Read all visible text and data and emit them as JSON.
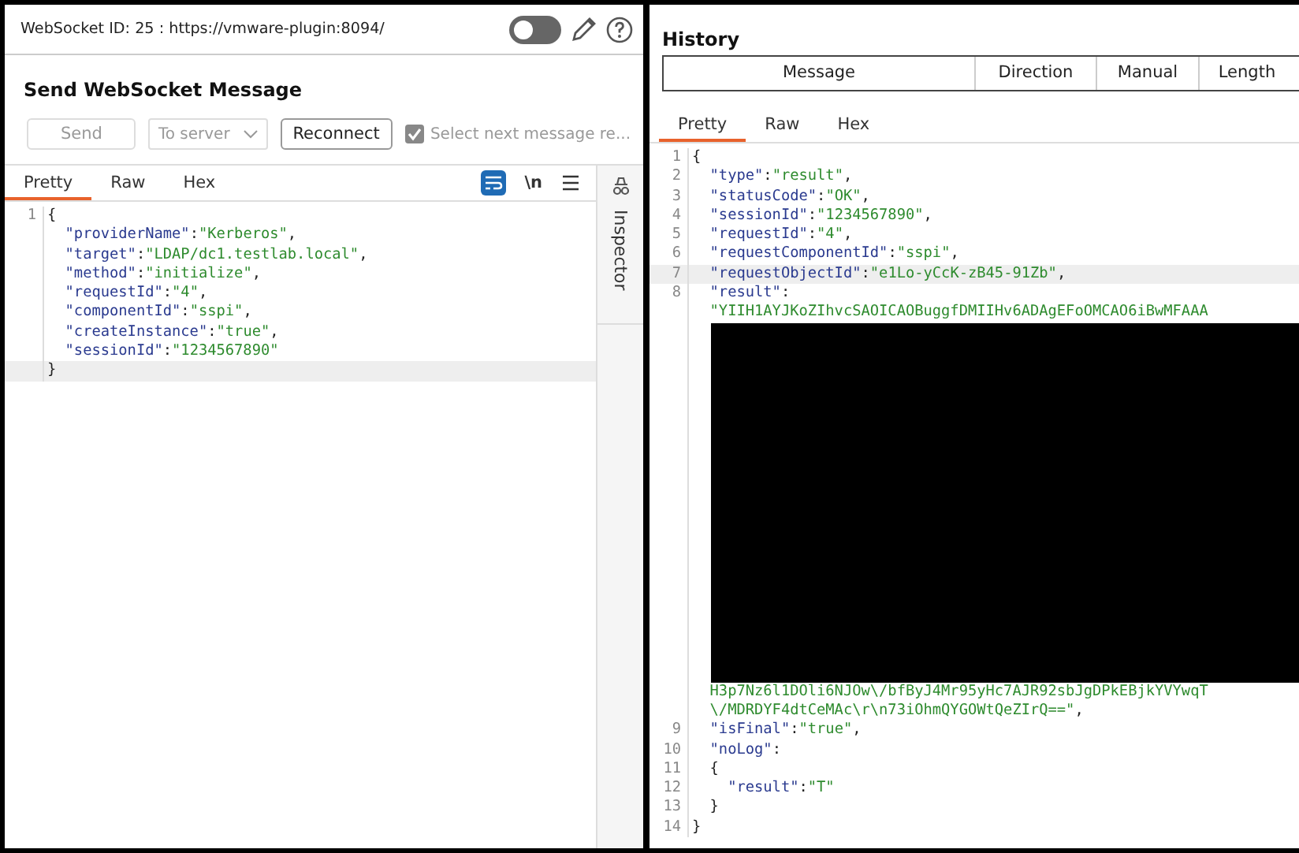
{
  "left_pane": {
    "header": {
      "title": "WebSocket ID: 25 : https://vmware-plugin:8094/",
      "intercept_toggle": {
        "on": false
      }
    },
    "send_section": {
      "title": "Send WebSocket Message",
      "send_button": {
        "label": "Send",
        "disabled": true
      },
      "direction_select": {
        "value": "To server",
        "disabled": true
      },
      "reconnect_button": {
        "label": "Reconnect",
        "disabled": false
      },
      "select_next_checkbox": {
        "label": "Select next message re...",
        "checked": true,
        "disabled": true
      }
    },
    "editor_tabs": [
      {
        "label": "Pretty",
        "selected": true
      },
      {
        "label": "Raw",
        "selected": false
      },
      {
        "label": "Hex",
        "selected": false
      }
    ],
    "editor_tools": {
      "wrap_on": true,
      "newline_label": "\\n"
    },
    "code_lines": [
      {
        "kind": "code",
        "number": "1",
        "current": false,
        "tokens": [
          {
            "kind": "punct",
            "text": "{"
          }
        ]
      },
      {
        "kind": "code",
        "current": false,
        "tokens": [
          {
            "kind": "key",
            "text": "  \"providerName\""
          },
          {
            "kind": "punct",
            "text": ":"
          },
          {
            "kind": "string",
            "text": "\"Kerberos\""
          },
          {
            "kind": "punct",
            "text": ","
          }
        ]
      },
      {
        "kind": "code",
        "current": false,
        "tokens": [
          {
            "kind": "key",
            "text": "  \"target\""
          },
          {
            "kind": "punct",
            "text": ":"
          },
          {
            "kind": "string",
            "text": "\"LDAP/dc1.testlab.local\""
          },
          {
            "kind": "punct",
            "text": ","
          }
        ]
      },
      {
        "kind": "code",
        "current": false,
        "tokens": [
          {
            "kind": "key",
            "text": "  \"method\""
          },
          {
            "kind": "punct",
            "text": ":"
          },
          {
            "kind": "string",
            "text": "\"initialize\""
          },
          {
            "kind": "punct",
            "text": ","
          }
        ]
      },
      {
        "kind": "code",
        "current": false,
        "tokens": [
          {
            "kind": "key",
            "text": "  \"requestId\""
          },
          {
            "kind": "punct",
            "text": ":"
          },
          {
            "kind": "string",
            "text": "\"4\""
          },
          {
            "kind": "punct",
            "text": ","
          }
        ]
      },
      {
        "kind": "code",
        "current": false,
        "tokens": [
          {
            "kind": "key",
            "text": "  \"componentId\""
          },
          {
            "kind": "punct",
            "text": ":"
          },
          {
            "kind": "string",
            "text": "\"sspi\""
          },
          {
            "kind": "punct",
            "text": ","
          }
        ]
      },
      {
        "kind": "code",
        "current": false,
        "tokens": [
          {
            "kind": "key",
            "text": "  \"createInstance\""
          },
          {
            "kind": "punct",
            "text": ":"
          },
          {
            "kind": "string",
            "text": "\"true\""
          },
          {
            "kind": "punct",
            "text": ","
          }
        ]
      },
      {
        "kind": "code",
        "current": false,
        "tokens": [
          {
            "kind": "key",
            "text": "  \"sessionId\""
          },
          {
            "kind": "punct",
            "text": ":"
          },
          {
            "kind": "string",
            "text": "\"1234567890\""
          }
        ]
      },
      {
        "kind": "code",
        "current": true,
        "tokens": [
          {
            "kind": "punct",
            "text": "}"
          }
        ]
      }
    ],
    "inspector_label": "Inspector"
  },
  "right_pane": {
    "title": "History",
    "table": {
      "columns": [
        "Message",
        "Direction",
        "Manual",
        "Length"
      ]
    },
    "editor_tabs": [
      {
        "label": "Pretty",
        "selected": true
      },
      {
        "label": "Raw",
        "selected": false
      },
      {
        "label": "Hex",
        "selected": false
      }
    ],
    "code_lines": [
      {
        "kind": "code",
        "number": "1",
        "current": false,
        "tokens": [
          {
            "kind": "punct",
            "text": "{"
          }
        ]
      },
      {
        "kind": "code",
        "number": "2",
        "current": false,
        "tokens": [
          {
            "kind": "key",
            "text": "  \"type\""
          },
          {
            "kind": "punct",
            "text": ":"
          },
          {
            "kind": "string",
            "text": "\"result\""
          },
          {
            "kind": "punct",
            "text": ","
          }
        ]
      },
      {
        "kind": "code",
        "number": "3",
        "current": false,
        "tokens": [
          {
            "kind": "key",
            "text": "  \"statusCode\""
          },
          {
            "kind": "punct",
            "text": ":"
          },
          {
            "kind": "string",
            "text": "\"OK\""
          },
          {
            "kind": "punct",
            "text": ","
          }
        ]
      },
      {
        "kind": "code",
        "number": "4",
        "current": false,
        "tokens": [
          {
            "kind": "key",
            "text": "  \"sessionId\""
          },
          {
            "kind": "punct",
            "text": ":"
          },
          {
            "kind": "string",
            "text": "\"1234567890\""
          },
          {
            "kind": "punct",
            "text": ","
          }
        ]
      },
      {
        "kind": "code",
        "number": "5",
        "current": false,
        "tokens": [
          {
            "kind": "key",
            "text": "  \"requestId\""
          },
          {
            "kind": "punct",
            "text": ":"
          },
          {
            "kind": "string",
            "text": "\"4\""
          },
          {
            "kind": "punct",
            "text": ","
          }
        ]
      },
      {
        "kind": "code",
        "number": "6",
        "current": false,
        "tokens": [
          {
            "kind": "key",
            "text": "  \"requestComponentId\""
          },
          {
            "kind": "punct",
            "text": ":"
          },
          {
            "kind": "string",
            "text": "\"sspi\""
          },
          {
            "kind": "punct",
            "text": ","
          }
        ]
      },
      {
        "kind": "code",
        "number": "7",
        "current": true,
        "tokens": [
          {
            "kind": "key",
            "text": "  \"requestObjectId\""
          },
          {
            "kind": "punct",
            "text": ":"
          },
          {
            "kind": "string",
            "text": "\"e1Lo-yCcK-zB45-91Zb\""
          },
          {
            "kind": "punct",
            "text": ","
          }
        ]
      },
      {
        "kind": "code",
        "number": "8",
        "current": false,
        "tokens": [
          {
            "kind": "key",
            "text": "  \"result\""
          },
          {
            "kind": "punct",
            "text": ":"
          }
        ]
      },
      {
        "kind": "code",
        "current": false,
        "tokens": [
          {
            "kind": "string",
            "text": "  \"YIIH1AYJKoZIhvcSAOICAOBuggfDMIIHv6ADAgEFoOMCAO6iBwMFAAA"
          }
        ]
      },
      {
        "kind": "redacted"
      },
      {
        "kind": "code",
        "current": false,
        "tokens": [
          {
            "kind": "string",
            "text": "  H3p7Nz6l1DOli6NJOw\\/bfByJ4Mr95yHc7AJR92sbJgDPkEBjkYVYwqT"
          }
        ]
      },
      {
        "kind": "code",
        "current": false,
        "tokens": [
          {
            "kind": "string",
            "text": "  \\/MDRDYF4dtCeMAc\\r\\n73iOhmQYGOWtQeZIrQ==\""
          },
          {
            "kind": "punct",
            "text": ","
          }
        ]
      },
      {
        "kind": "code",
        "number": "9",
        "current": false,
        "tokens": [
          {
            "kind": "key",
            "text": "  \"isFinal\""
          },
          {
            "kind": "punct",
            "text": ":"
          },
          {
            "kind": "string",
            "text": "\"true\""
          },
          {
            "kind": "punct",
            "text": ","
          }
        ]
      },
      {
        "kind": "code",
        "number": "10",
        "current": false,
        "tokens": [
          {
            "kind": "key",
            "text": "  \"noLog\""
          },
          {
            "kind": "punct",
            "text": ":"
          }
        ]
      },
      {
        "kind": "code",
        "number": "11",
        "current": false,
        "tokens": [
          {
            "kind": "punct",
            "text": "  {"
          }
        ]
      },
      {
        "kind": "code",
        "number": "12",
        "current": false,
        "tokens": [
          {
            "kind": "key",
            "text": "    \"result\""
          },
          {
            "kind": "punct",
            "text": ":"
          },
          {
            "kind": "string",
            "text": "\"T\""
          }
        ]
      },
      {
        "kind": "code",
        "number": "13",
        "current": false,
        "tokens": [
          {
            "kind": "punct",
            "text": "  }"
          }
        ]
      },
      {
        "kind": "code",
        "number": "14",
        "current": false,
        "tokens": [
          {
            "kind": "punct",
            "text": "}"
          }
        ]
      }
    ]
  }
}
